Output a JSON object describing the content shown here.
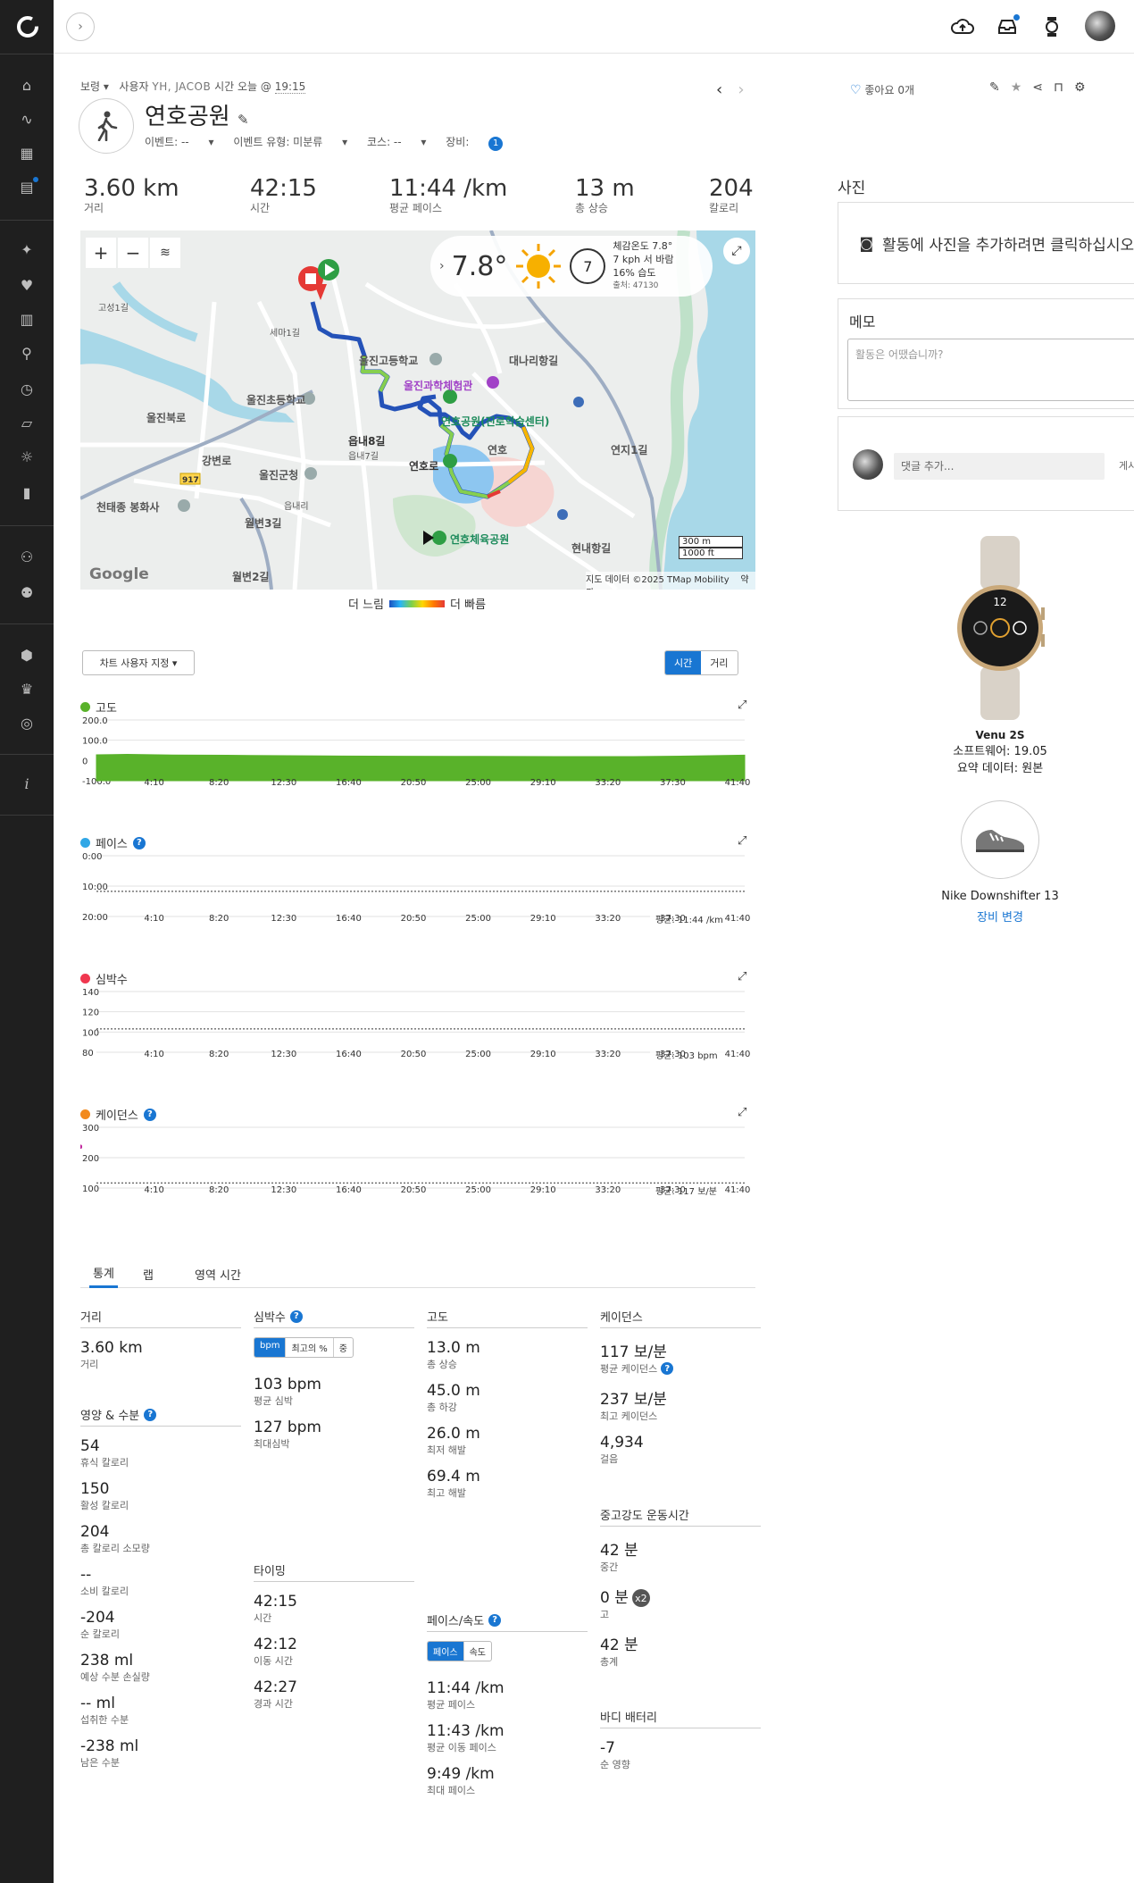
{
  "header": {
    "weather_unit_note": ""
  },
  "activity": {
    "privacy_label": "보령",
    "user_prefix": "사용자",
    "user_name": "YH, JACOB",
    "time_prefix": "시간 오늘 @",
    "time": "19:15",
    "title": "연호공원",
    "event_label": "이벤트: --",
    "event_type_label": "이벤트 유형: 미분류",
    "course_label": "코스: --",
    "gear_label": "장비:",
    "gear_count": "1",
    "like_label": "좋아요 0개"
  },
  "summary": [
    {
      "value": "3.60 km",
      "label": "거리"
    },
    {
      "value": "42:15",
      "label": "시간"
    },
    {
      "value": "11:44 /km",
      "label": "평균 페이스"
    },
    {
      "value": "13 m",
      "label": "총 상승"
    },
    {
      "value": "204",
      "label": "칼로리"
    }
  ],
  "map": {
    "temperature": "7.8°",
    "wind_speed": "7",
    "feels_like": "체감온도 7.8°",
    "wind": "7 kph 서 바람",
    "humidity": "16% 습도",
    "station": "출처: 47130",
    "scale_m": "300 m",
    "scale_ft": "1000 ft",
    "attribution": "지도 데이터 ©2025 TMap Mobility",
    "terms": "약관",
    "google": "Google",
    "labels": [
      {
        "text": "울진과학체험관",
        "color": "#a142c7"
      },
      {
        "text": "연호공원(진로학습센터)",
        "color": "#1b8a5a"
      },
      {
        "text": "연호체육공원",
        "color": "#1b8a5a"
      },
      {
        "text": "울진고등학교",
        "color": "#555"
      },
      {
        "text": "울진초등학교",
        "color": "#555"
      },
      {
        "text": "울진군청",
        "color": "#555"
      },
      {
        "text": "천태종 봉화사",
        "color": "#555"
      },
      {
        "text": "대나리항길",
        "color": "#555"
      },
      {
        "text": "연호",
        "color": "#555"
      },
      {
        "text": "연호로",
        "color": "#333"
      },
      {
        "text": "읍내8길",
        "color": "#333"
      },
      {
        "text": "읍내7길",
        "color": "#555"
      },
      {
        "text": "울진북로",
        "color": "#555"
      },
      {
        "text": "강변로",
        "color": "#555"
      },
      {
        "text": "현내항길",
        "color": "#555"
      },
      {
        "text": "연지1길",
        "color": "#555"
      },
      {
        "text": "월변3길",
        "color": "#555"
      },
      {
        "text": "월변2길",
        "color": "#555"
      },
      {
        "text": "고성1길",
        "color": "#555"
      },
      {
        "text": "세마1길",
        "color": "#555"
      },
      {
        "text": "읍내리",
        "color": "#555"
      },
      {
        "text": "917",
        "color": "#333"
      }
    ],
    "legend_slow": "더 느림",
    "legend_fast": "더 빠름"
  },
  "charts_controls": {
    "customize": "차트 사용자 지정 ▾",
    "toggle_time": "시간",
    "toggle_distance": "거리"
  },
  "chart_data": [
    {
      "type": "area",
      "title": "고도",
      "color": "#59b22a",
      "x_ticks": [
        "4:10",
        "8:20",
        "12:30",
        "16:40",
        "20:50",
        "25:00",
        "29:10",
        "33:20",
        "37:30",
        "41:40"
      ],
      "y_ticks": [
        "200.0",
        "100.0",
        "0",
        "-100.0"
      ],
      "ylim": [
        -100,
        200
      ],
      "x_max_min": 42.25,
      "series_points": [
        [
          0,
          28
        ],
        [
          2,
          30
        ],
        [
          5,
          27
        ],
        [
          10,
          25
        ],
        [
          15,
          22
        ],
        [
          20,
          21
        ],
        [
          25,
          20
        ],
        [
          30,
          19
        ],
        [
          35,
          19
        ],
        [
          39,
          22
        ],
        [
          42.25,
          26
        ]
      ]
    },
    {
      "type": "area",
      "title": "페이스",
      "color": "#30a7e6",
      "x_ticks": [
        "4:10",
        "8:20",
        "12:30",
        "16:40",
        "20:50",
        "25:00",
        "29:10",
        "33:20",
        "37:30",
        "41:40"
      ],
      "y_ticks": [
        "0:00",
        "10:00",
        "20:00"
      ],
      "ylim": [
        0,
        20
      ],
      "inverted": true,
      "avg_label": "평균: 11:44 /km",
      "avg": 11.73,
      "series_points": [
        [
          0,
          11.5
        ],
        [
          2,
          11.2
        ],
        [
          4,
          12.0
        ],
        [
          6,
          11.4
        ],
        [
          8,
          11.8
        ],
        [
          10,
          11.3
        ],
        [
          12,
          12.1
        ],
        [
          14,
          11.6
        ],
        [
          16,
          11.2
        ],
        [
          18,
          11.9
        ],
        [
          20,
          11.5
        ],
        [
          22,
          12.0
        ],
        [
          24,
          11.4
        ],
        [
          26,
          11.8
        ],
        [
          28,
          11.6
        ],
        [
          30,
          12.2
        ],
        [
          32,
          11.3
        ],
        [
          34,
          11.7
        ],
        [
          36,
          11.9
        ],
        [
          38,
          11.5
        ],
        [
          40,
          11.8
        ],
        [
          42.25,
          11.4
        ]
      ]
    },
    {
      "type": "area",
      "title": "심박수",
      "color": "#f0374f",
      "x_ticks": [
        "4:10",
        "8:20",
        "12:30",
        "16:40",
        "20:50",
        "25:00",
        "29:10",
        "33:20",
        "37:30",
        "41:40"
      ],
      "y_ticks": [
        "140",
        "120",
        "100",
        "80"
      ],
      "ylim": [
        80,
        140
      ],
      "avg_label": "평균: 103 bpm",
      "avg": 103,
      "series_points": [
        [
          0,
          92
        ],
        [
          2,
          98
        ],
        [
          4,
          102
        ],
        [
          6,
          100
        ],
        [
          8,
          104
        ],
        [
          10,
          101
        ],
        [
          12,
          103
        ],
        [
          14,
          100
        ],
        [
          16,
          102
        ],
        [
          18,
          104
        ],
        [
          20,
          101
        ],
        [
          22,
          103
        ],
        [
          24,
          102
        ],
        [
          26,
          104
        ],
        [
          28,
          101
        ],
        [
          30,
          103
        ],
        [
          32,
          102
        ],
        [
          34,
          104
        ],
        [
          36,
          103
        ],
        [
          38,
          105
        ],
        [
          39.5,
          118
        ],
        [
          40.5,
          112
        ],
        [
          42.25,
          114
        ]
      ]
    },
    {
      "type": "scatter",
      "title": "케이던스",
      "color": "#d41a3c",
      "x_ticks": [
        "4:10",
        "8:20",
        "12:30",
        "16:40",
        "20:50",
        "25:00",
        "29:10",
        "33:20",
        "37:30",
        "41:40"
      ],
      "y_ticks": [
        "300",
        "200",
        "100"
      ],
      "ylim": [
        100,
        300
      ],
      "avg_label": "평균: 117 보/분",
      "avg": 117,
      "series_points": [
        [
          0,
          116
        ],
        [
          5,
          118
        ],
        [
          10,
          117
        ],
        [
          15,
          116
        ],
        [
          20,
          118
        ],
        [
          25,
          117
        ],
        [
          30,
          116
        ],
        [
          35,
          118
        ],
        [
          40,
          117
        ],
        [
          42.25,
          116
        ]
      ],
      "outliers": [
        [
          29.5,
          237
        ],
        [
          34.5,
          235
        ]
      ]
    }
  ],
  "tabs": [
    "통계",
    "랩",
    "영역 시간"
  ],
  "stats": {
    "distance": {
      "header": "거리",
      "value": "3.60 km",
      "label": "거리"
    },
    "nutrition": {
      "header": "영양 & 수분",
      "items": [
        {
          "value": "54",
          "label": "휴식 칼로리"
        },
        {
          "value": "150",
          "label": "활성 칼로리"
        },
        {
          "value": "204",
          "label": "총 칼로리 소모량"
        },
        {
          "value": "--",
          "label": "소비 칼로리"
        },
        {
          "value": "-204",
          "label": "순 칼로리"
        },
        {
          "value": "238 ml",
          "label": "예상 수분 손실량"
        },
        {
          "value": "-- ml",
          "label": "섭취한 수분"
        },
        {
          "value": "-238 ml",
          "label": "남은 수분"
        }
      ]
    },
    "hr": {
      "header": "심박수",
      "toggle": [
        "bpm",
        "최고의 %",
        "중"
      ],
      "items": [
        {
          "value": "103 bpm",
          "label": "평균 심박"
        },
        {
          "value": "127 bpm",
          "label": "최대심박"
        }
      ]
    },
    "timing": {
      "header": "타이밍",
      "items": [
        {
          "value": "42:15",
          "label": "시간"
        },
        {
          "value": "42:12",
          "label": "이동 시간"
        },
        {
          "value": "42:27",
          "label": "경과 시간"
        }
      ]
    },
    "elevation": {
      "header": "고도",
      "items": [
        {
          "value": "13.0 m",
          "label": "총 상승"
        },
        {
          "value": "45.0 m",
          "label": "총 하강"
        },
        {
          "value": "26.0 m",
          "label": "최저 해발"
        },
        {
          "value": "69.4 m",
          "label": "최고 해발"
        }
      ]
    },
    "pace": {
      "header": "페이스/속도",
      "toggle": [
        "페이스",
        "속도"
      ],
      "items": [
        {
          "value": "11:44 /km",
          "label": "평균 페이스"
        },
        {
          "value": "11:43 /km",
          "label": "평균 이동 페이스"
        },
        {
          "value": "9:49 /km",
          "label": "최대 페이스"
        }
      ]
    },
    "cadence": {
      "header": "케이던스",
      "items": [
        {
          "value": "117 보/분",
          "label": "평균 케이던스"
        },
        {
          "value": "237 보/분",
          "label": "최고 케이던스"
        },
        {
          "value": "4,934",
          "label": "걸음"
        }
      ]
    },
    "intensity": {
      "header": "중고강도 운동시간",
      "items": [
        {
          "value": "42 분",
          "label": "중간"
        },
        {
          "value": "0 분",
          "label": "고",
          "badge": "x2"
        },
        {
          "value": "42 분",
          "label": "총계"
        }
      ]
    },
    "battery": {
      "header": "바디 배터리",
      "value": "-7",
      "label": "순 영향"
    }
  },
  "right": {
    "photos_header": "사진",
    "photos_add": "활동에 사진을 추가하려면 클릭하십시오.",
    "memo_header": "메모",
    "memo_placeholder": "활동은 어땠습니까?",
    "comment_placeholder": "댓글 추가...",
    "comment_post": "게시",
    "device_name": "Venu 2S",
    "device_software": "소프트웨어: 19.05",
    "device_summary": "요약 데이터: 원본",
    "watch_time": "12",
    "shoe_name": "Nike Downshifter 13",
    "change_gear": "장비 변경"
  },
  "colors": {
    "accent": "#1976d2",
    "sidebar": "#1f1f1f"
  }
}
